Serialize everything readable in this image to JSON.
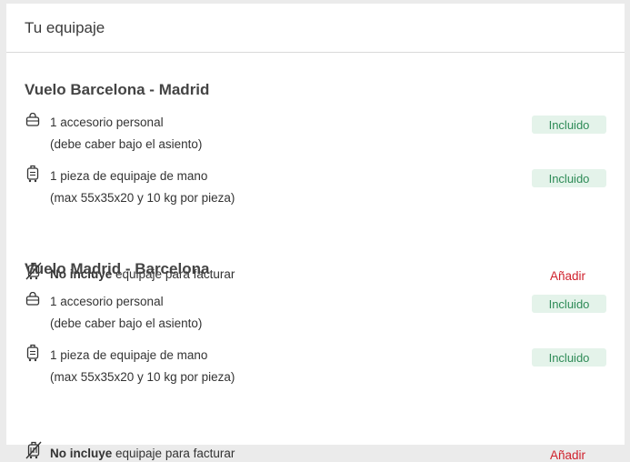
{
  "header": {
    "title": "Tu equipaje"
  },
  "flights": [
    {
      "title": "Vuelo Barcelona - Madrid",
      "personal_item": {
        "line1": "1 accesorio personal",
        "line2": "(debe caber bajo el asiento)",
        "status": "Incluido"
      },
      "hand_luggage": {
        "line1": "1 pieza de equipaje de mano",
        "line2": "(max 55x35x20 y 10 kg por pieza)",
        "status": "Incluido"
      },
      "checked": {
        "bold": "No incluye",
        "rest": " equipaje para facturar",
        "action": "Añadir"
      }
    },
    {
      "title": "Vuelo Madrid - Barcelona",
      "personal_item": {
        "line1": "1 accesorio personal",
        "line2": "(debe caber bajo el asiento)",
        "status": "Incluido"
      },
      "hand_luggage": {
        "line1": "1 pieza de equipaje de mano",
        "line2": "(max 55x35x20 y 10 kg por pieza)",
        "status": "Incluido"
      },
      "checked": {
        "bold": "No incluye",
        "rest": " equipaje para facturar",
        "action": "Añadir"
      }
    }
  ],
  "colors": {
    "included_bg": "#e4f3ea",
    "included_text": "#2e8b57",
    "add_link": "#d0222d"
  },
  "icons": {
    "personal_item": "bag-icon",
    "hand_luggage": "trolley-icon",
    "checked": "no-luggage-icon"
  }
}
